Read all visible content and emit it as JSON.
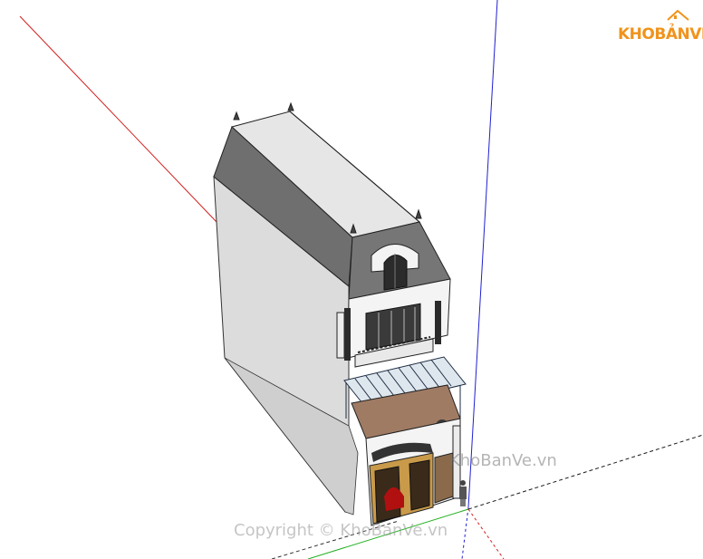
{
  "logo": {
    "text_kho": "KHO",
    "text_banve": "BẢNVẼ"
  },
  "watermarks": {
    "middle": "KhoBanVe.vn",
    "bottom": "Copyright © KhoBanVe.vn"
  },
  "colors": {
    "axis_red": "#d22020",
    "axis_green": "#20b020",
    "axis_blue": "#2020d0",
    "logo_orange": "#f0931c",
    "roof": "#6f6f6f",
    "wall_side": "#dcdcdc",
    "wall_front": "#f4f4f4",
    "door_gold": "#c99a4a"
  }
}
